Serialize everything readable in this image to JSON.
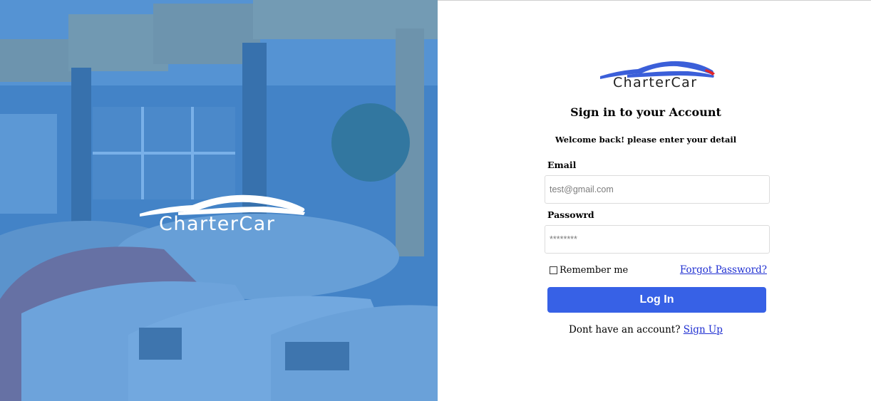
{
  "hero": {
    "brand_name": "CharterCar",
    "logo_icon": "car-silhouette-icon"
  },
  "form": {
    "brand_name": "CharterCar",
    "logo_icon": "car-silhouette-icon",
    "title": "Sign in to your Account",
    "subtitle": "Welcome back! please enter your detail",
    "email": {
      "label": "Email",
      "placeholder": "test@gmail.com",
      "value": ""
    },
    "password": {
      "label": "Passowrd",
      "placeholder": "********",
      "value": ""
    },
    "remember_label": "Remember me",
    "remember_checked": false,
    "forgot_label": "Forgot Password?",
    "login_label": "Log In",
    "signup_prompt": "Dont have an account?",
    "signup_label": "Sign Up"
  },
  "colors": {
    "hero_overlay": "#3589de",
    "primary_button": "#3761e6",
    "link": "#1f2fd1",
    "logo_blue": "#3b5fd9",
    "logo_red": "#e0242a"
  }
}
